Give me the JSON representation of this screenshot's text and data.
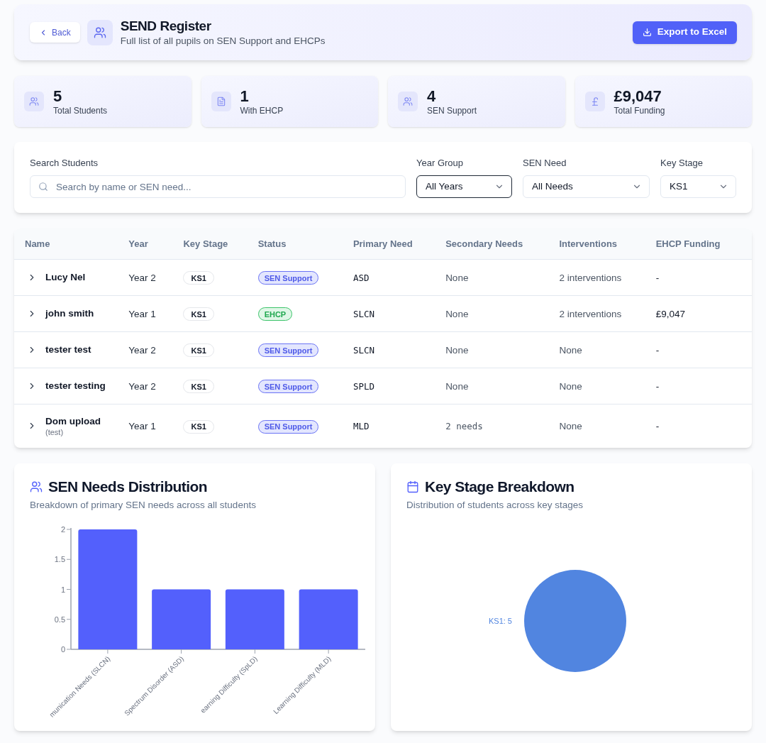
{
  "header": {
    "back_button": "Back",
    "title": "SEND Register",
    "subtitle": "Full list of all pupils on SEN Support and EHCPs",
    "export_button": "Export to Excel"
  },
  "stats": [
    {
      "kind": "students",
      "value": "5",
      "label": "Total Students"
    },
    {
      "kind": "ehcp",
      "value": "1",
      "label": "With EHCP"
    },
    {
      "kind": "support",
      "value": "4",
      "label": "SEN Support"
    },
    {
      "kind": "funding",
      "value": "£9,047",
      "label": "Total Funding"
    }
  ],
  "filters": {
    "search": {
      "label": "Search Students",
      "placeholder": "Search by name or SEN need..."
    },
    "selects": [
      {
        "label": "Year Group",
        "value": "All Years",
        "focused": true
      },
      {
        "label": "SEN Need",
        "value": "All Needs",
        "focused": false
      },
      {
        "label": "Key Stage",
        "value": "KS1",
        "focused": false
      }
    ]
  },
  "table": {
    "columns": [
      "Name",
      "Year",
      "Key Stage",
      "Status",
      "Primary Need",
      "Secondary Needs",
      "Interventions",
      "EHCP Funding"
    ],
    "rows": [
      {
        "expanded": false,
        "name": "Lucy Nel",
        "year": "Year 2",
        "key_stage": "KS1",
        "status": {
          "kind": "sen_support",
          "label": "SEN Support"
        },
        "primary_need": "ASD",
        "secondary_needs": {
          "kind": "none",
          "text": "None"
        },
        "interventions": "2 interventions",
        "ehcp_funding": "-"
      },
      {
        "expanded": false,
        "name": "john smith",
        "year": "Year 1",
        "key_stage": "KS1",
        "status": {
          "kind": "ehcp",
          "label": "EHCP"
        },
        "primary_need": "SLCN",
        "secondary_needs": {
          "kind": "none",
          "text": "None"
        },
        "interventions": "2 interventions",
        "ehcp_funding": "£9,047"
      },
      {
        "expanded": false,
        "name": "tester test",
        "year": "Year 2",
        "key_stage": "KS1",
        "status": {
          "kind": "sen_support",
          "label": "SEN Support"
        },
        "primary_need": "SLCN",
        "secondary_needs": {
          "kind": "none",
          "text": "None"
        },
        "interventions": "None",
        "ehcp_funding": "-"
      },
      {
        "expanded": false,
        "name": "tester testing",
        "year": "Year 2",
        "key_stage": "KS1",
        "status": {
          "kind": "sen_support",
          "label": "SEN Support"
        },
        "primary_need": "SPLD",
        "secondary_needs": {
          "kind": "none",
          "text": "None"
        },
        "interventions": "None",
        "ehcp_funding": "-"
      },
      {
        "expanded": false,
        "name": "Dom upload",
        "note": "(test)",
        "year": "Year 1",
        "key_stage": "KS1",
        "status": {
          "kind": "sen_support",
          "label": "SEN Support"
        },
        "primary_need": "MLD",
        "secondary_needs": {
          "kind": "count",
          "text": "2 needs"
        },
        "interventions": "None",
        "ehcp_funding": "-"
      }
    ]
  },
  "charts": [
    {
      "kind": "needs",
      "title": "SEN Needs Distribution",
      "subtitle": "Breakdown of primary SEN needs across all students",
      "chart_data": {
        "type": "bar",
        "categories": [
          "munication Needs (SLCN)",
          "Spectrum Disorder (ASD)",
          "earning Difficulty (SpLD)",
          "Learning Difficulty (MLD)"
        ],
        "values": [
          2,
          1,
          1,
          1
        ],
        "ylim": [
          0,
          2
        ],
        "yticks": [
          0,
          0.5,
          1,
          1.5,
          2
        ]
      }
    },
    {
      "kind": "stages",
      "title": "Key Stage Breakdown",
      "subtitle": "Distribution of students across key stages",
      "chart_data": {
        "type": "pie",
        "values": [
          5
        ],
        "value_labels": [
          "KS1: 5"
        ]
      }
    }
  ]
}
